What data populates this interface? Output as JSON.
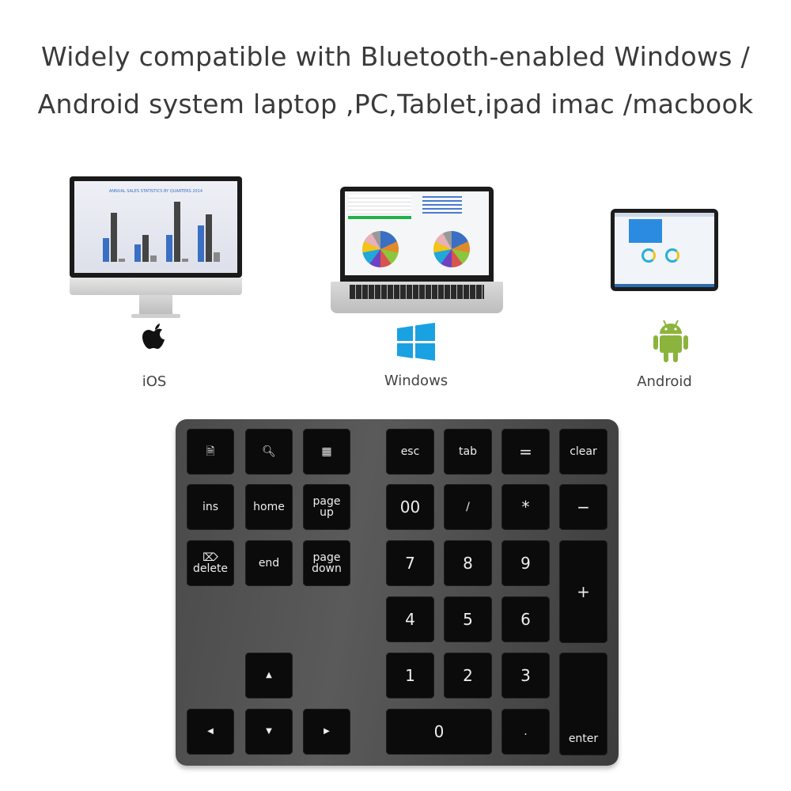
{
  "headline": {
    "line1": "Widely compatible with Bluetooth-enabled Windows /",
    "line2": "Android system laptop ,PC,Tablet,ipad imac /macbook"
  },
  "devices": [
    {
      "name": "imac",
      "label": "iOS",
      "icon": "apple-logo-icon",
      "screen_title": "ANNUAL SALES STATISTICS BY QUARTERS 2014"
    },
    {
      "name": "laptop",
      "label": "Windows",
      "icon": "windows-logo-icon"
    },
    {
      "name": "tablet",
      "label": "Android",
      "icon": "android-robot-icon"
    }
  ],
  "colors": {
    "apple": "#111111",
    "windows": "#1aa1e1",
    "android": "#8cb43c",
    "keycap": "#0b0b0b",
    "body": "#4a4a4a"
  },
  "keyboard": {
    "left_keys": [
      {
        "id": "file",
        "icon": "file-icon",
        "label": "🗎"
      },
      {
        "id": "search",
        "icon": "search-icon",
        "label": "🔍︎"
      },
      {
        "id": "calculator",
        "icon": "calculator-icon",
        "label": "▦"
      },
      {
        "id": "ins",
        "label": "ins"
      },
      {
        "id": "home",
        "label": "home"
      },
      {
        "id": "page-up",
        "label": "page\nup"
      },
      {
        "id": "delete",
        "label": "⌦\ndelete"
      },
      {
        "id": "end",
        "label": "end"
      },
      {
        "id": "page-down",
        "label": "page\ndown"
      },
      {
        "id": "arrow-up",
        "icon": "arrow-up-icon",
        "label": "▲"
      },
      {
        "id": "arrow-left",
        "icon": "arrow-left-icon",
        "label": "◀"
      },
      {
        "id": "arrow-down",
        "icon": "arrow-down-icon",
        "label": "▼"
      },
      {
        "id": "arrow-right",
        "icon": "arrow-right-icon",
        "label": "▶"
      }
    ],
    "numpad_keys": [
      {
        "id": "esc",
        "label": "esc"
      },
      {
        "id": "tab",
        "label": "tab"
      },
      {
        "id": "equals",
        "label": "="
      },
      {
        "id": "clear",
        "label": "clear"
      },
      {
        "id": "double-zero",
        "label": "00"
      },
      {
        "id": "divide",
        "label": "/"
      },
      {
        "id": "multiply",
        "label": "*"
      },
      {
        "id": "minus",
        "label": "−"
      },
      {
        "id": "seven",
        "label": "7"
      },
      {
        "id": "eight",
        "label": "8"
      },
      {
        "id": "nine",
        "label": "9"
      },
      {
        "id": "plus",
        "label": "+"
      },
      {
        "id": "four",
        "label": "4"
      },
      {
        "id": "five",
        "label": "5"
      },
      {
        "id": "six",
        "label": "6"
      },
      {
        "id": "one",
        "label": "1"
      },
      {
        "id": "two",
        "label": "2"
      },
      {
        "id": "three",
        "label": "3"
      },
      {
        "id": "enter",
        "label": "enter"
      },
      {
        "id": "zero",
        "label": "0"
      },
      {
        "id": "decimal",
        "label": "."
      }
    ]
  }
}
